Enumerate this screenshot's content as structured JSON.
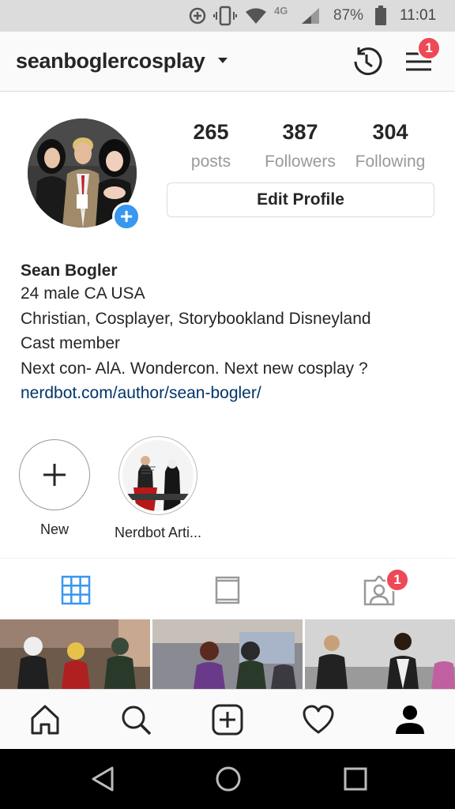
{
  "status_bar": {
    "network": "4G",
    "battery": "87%",
    "time": "11:01"
  },
  "header": {
    "username": "seanboglercosplay",
    "menu_badge": "1"
  },
  "profile": {
    "stats": [
      {
        "count": "265",
        "label": "posts"
      },
      {
        "count": "387",
        "label": "Followers"
      },
      {
        "count": "304",
        "label": "Following"
      }
    ],
    "edit_button": "Edit Profile"
  },
  "bio": {
    "name": "Sean Bogler",
    "lines": [
      "24 male CA USA",
      "Christian, Cosplayer, Storybookland Disneyland",
      "Cast member",
      "Next con- AlA. Wondercon. Next new cosplay ?"
    ],
    "link": "nerdbot.com/author/sean-bogler/"
  },
  "highlights": [
    {
      "label": "New"
    },
    {
      "label": "Nerdbot Arti..."
    }
  ],
  "tabs": {
    "tagged_badge": "1"
  },
  "icons": {
    "status": [
      "add-circle-icon",
      "vibrate-icon",
      "wifi-icon",
      "signal-icon",
      "battery-icon"
    ],
    "header": [
      "caret-down-icon",
      "archive-history-icon",
      "menu-icon"
    ],
    "tabs": [
      "grid-icon",
      "feed-icon",
      "tagged-icon"
    ],
    "bottom_nav": [
      "home-icon",
      "search-icon",
      "add-post-icon",
      "heart-icon",
      "profile-icon"
    ],
    "android": [
      "back-icon",
      "home-circle-icon",
      "recents-icon"
    ]
  },
  "colors": {
    "accent_blue": "#3897f0",
    "badge_red": "#ed4956",
    "link": "#003569",
    "status_bar": "#dcdcdc"
  }
}
